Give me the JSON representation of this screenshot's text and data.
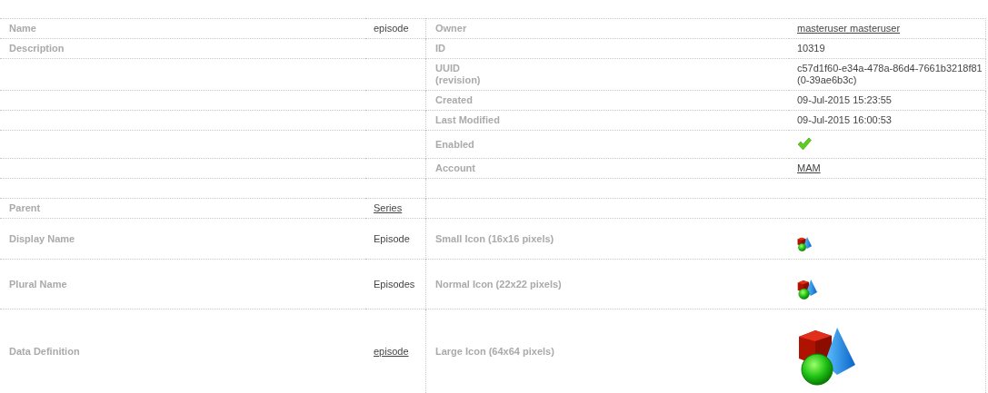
{
  "rows": [
    {
      "left": {
        "label": "Name",
        "value": "episode",
        "kind": "text"
      },
      "right": {
        "label": "Owner",
        "value": "masteruser masteruser",
        "kind": "link"
      }
    },
    {
      "left": {
        "label": "Description"
      },
      "right": {
        "label": "ID",
        "value": "10319",
        "kind": "text"
      }
    },
    {
      "right": {
        "label": "UUID\n(revision)",
        "value": "c57d1f60-e34a-478a-86d4-7661b3218f81\n(0-39ae6b3c)",
        "kind": "text"
      }
    },
    {
      "right": {
        "label": "Created",
        "value": "09-Jul-2015 15:23:55",
        "kind": "text"
      }
    },
    {
      "right": {
        "label": "Last Modified",
        "value": "09-Jul-2015 16:00:53",
        "kind": "text"
      }
    },
    {
      "right": {
        "label": "Enabled",
        "kind": "check",
        "checked": true
      }
    },
    {
      "right": {
        "label": "Account",
        "value": "MAM",
        "kind": "link"
      }
    },
    {},
    {
      "left": {
        "label": "Parent",
        "value": "Series",
        "kind": "link"
      }
    },
    {
      "left": {
        "label": "Display Name",
        "value": "Episode",
        "kind": "text"
      },
      "right": {
        "label": "Small Icon (16x16 pixels)",
        "kind": "icon16"
      }
    },
    {
      "left": {
        "label": "Plural Name",
        "value": "Episodes",
        "kind": "text"
      },
      "right": {
        "label": "Normal Icon (22x22 pixels)",
        "kind": "icon22"
      }
    },
    {
      "left": {
        "label": "Data Definition",
        "value": "episode",
        "kind": "link"
      },
      "right": {
        "label": "Large Icon (64x64 pixels)",
        "kind": "icon64"
      }
    }
  ]
}
